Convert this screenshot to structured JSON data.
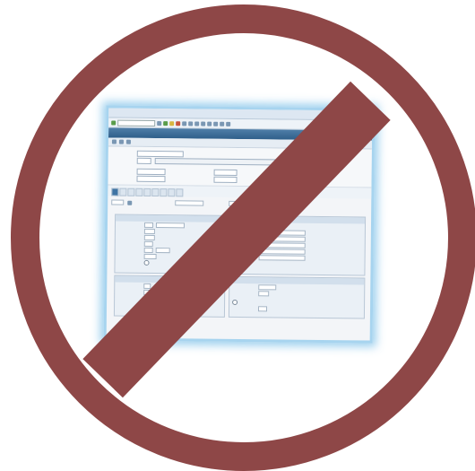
{
  "graphic": {
    "overlay": "prohibition-sign",
    "color": "#8e4747"
  },
  "sap_window": {
    "menu_items": [
      "",
      "",
      "",
      "",
      "",
      "",
      "",
      ""
    ],
    "title": "",
    "tabs": [
      "",
      "",
      "",
      "",
      "",
      "",
      "",
      "",
      ""
    ],
    "header_fields": [
      "",
      "",
      "",
      "",
      ""
    ],
    "left_panel_title": "",
    "right_panel_title": "",
    "bottom_left_title": "",
    "bottom_right_title": ""
  }
}
